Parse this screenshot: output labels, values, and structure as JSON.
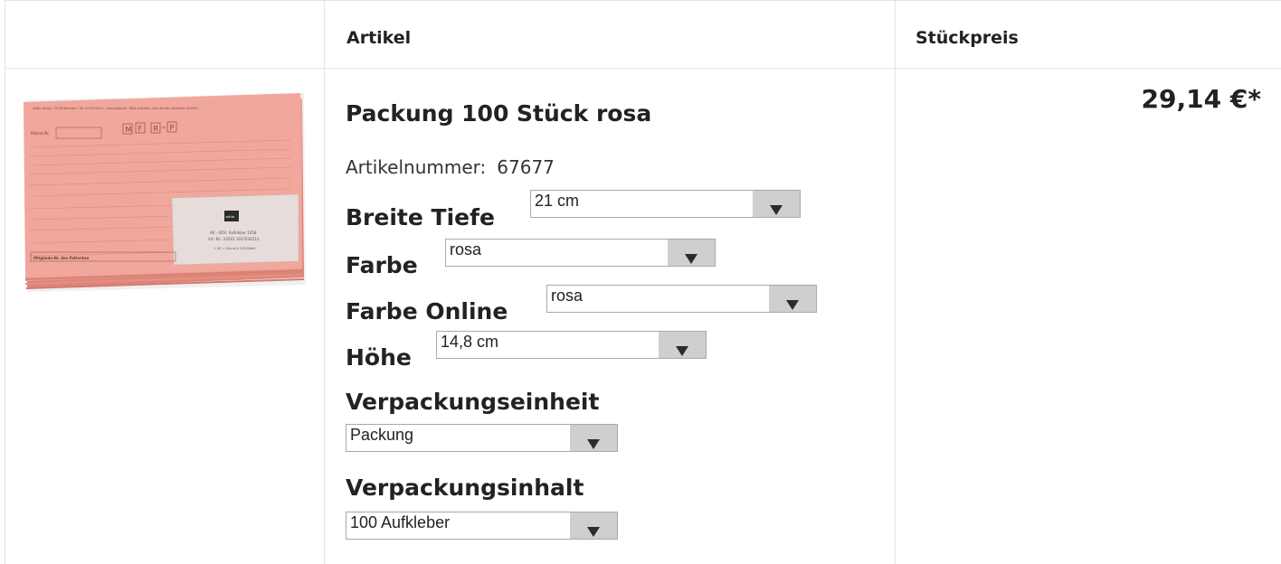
{
  "table": {
    "headers": {
      "article": "Artikel",
      "unit_price": "Stückpreis"
    }
  },
  "product": {
    "title": "Packung 100 Stück rosa",
    "article_number_label": "Artikelnummer:",
    "article_number": "67677",
    "price": "29,14 €*",
    "image_print": {
      "company_line": "Spitta Verlag · 72336 Balingen · Tel. 07433 952-0 · www.spitta.de · Bitte Aufkleber nicht bei der Zahlstelle 02/2015",
      "field_label": "Patient-Nr.",
      "boxes": [
        "M",
        "F",
        "R",
        "P"
      ],
      "brand": "spitta",
      "label_line1": "AK – EDV, Aufkleber 1058",
      "label_line2": "Art.-Nr.: 24563   1037034214",
      "label_line3": "1 VE = Bund à 100 Blatt",
      "footer": "Mitglieds-Nr. des Patienten"
    }
  },
  "options": [
    {
      "label": "Breite Tiefe",
      "value": "21 cm"
    },
    {
      "label": "Farbe",
      "value": "rosa"
    },
    {
      "label": "Farbe Online",
      "value": "rosa"
    },
    {
      "label": "Höhe",
      "value": "14,8 cm"
    },
    {
      "label": "Verpackungseinheit",
      "value": "Packung"
    },
    {
      "label": "Verpackungsinhalt",
      "value": "100 Aufkleber"
    }
  ],
  "colors": {
    "pink_card": "#ed9d93",
    "select_button": "#cfcfcf",
    "grid_line": "#e4e4e4"
  }
}
